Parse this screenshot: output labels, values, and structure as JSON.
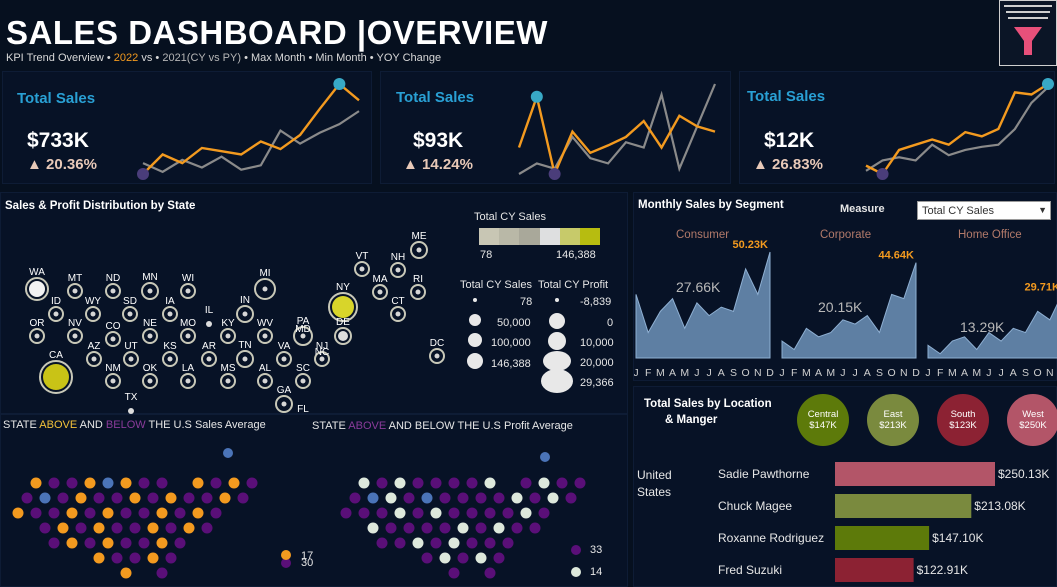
{
  "header": {
    "title": "SALES DASHBOARD |OVERVIEW",
    "subtitle_prefix": "KPI Trend Overview •",
    "subtitle_cy": "2022",
    "subtitle_vs": "vs •",
    "subtitle_py": "2021(CY vs PY)",
    "subtitle_max": "• Max Month",
    "subtitle_min": "• Min Month",
    "subtitle_yoy": "• YOY Change"
  },
  "colors": {
    "cy": "#f39a1f",
    "py": "#8a8a8a",
    "max_min": "#38a9c6",
    "min_dot": "#4a3d7a",
    "kpi_label": "#29a0d4",
    "above": "#f39a1f",
    "below": "#5a0f78",
    "area": "#5e7fa3"
  },
  "kpis": [
    {
      "label": "Total Sales",
      "value": "$733K",
      "change": "20.36%",
      "cy": [
        12,
        30,
        22,
        36,
        33,
        30,
        42,
        35,
        48,
        72,
        95,
        80
      ],
      "py": [
        22,
        14,
        25,
        18,
        28,
        16,
        20,
        52,
        40,
        50,
        58,
        70
      ]
    },
    {
      "label": "Total Sales",
      "value": "$93K",
      "change": "14.24%",
      "cy": [
        40,
        88,
        15,
        55,
        35,
        42,
        50,
        65,
        40,
        70,
        60,
        55
      ],
      "py": [
        15,
        25,
        20,
        50,
        30,
        25,
        45,
        40,
        90,
        20,
        60,
        100
      ]
    },
    {
      "label": "Total Sales",
      "value": "$12K",
      "change": "26.83%",
      "cy": [
        20,
        12,
        35,
        40,
        45,
        40,
        52,
        48,
        55,
        90,
        88,
        98
      ],
      "py": [
        15,
        25,
        28,
        25,
        40,
        30,
        35,
        38,
        40,
        55,
        80,
        95
      ]
    }
  ],
  "state_map": {
    "title": "Sales & Profit Distribution by State",
    "legend_title": "Total CY Sales",
    "legend_min": "78",
    "legend_max": "146,388",
    "size_legend_sales_title": "Total CY Sales",
    "size_legend_profit_title": "Total CY Profit",
    "size_legend_sales": [
      "78",
      "50,000",
      "100,000",
      "146,388"
    ],
    "size_legend_profit": [
      "-8,839",
      "0",
      "10,000",
      "20,000",
      "29,366"
    ],
    "states": [
      "WA",
      "MT",
      "ND",
      "MN",
      "WI",
      "MI",
      "VT",
      "NH",
      "ME",
      "ID",
      "WY",
      "SD",
      "IA",
      "IL",
      "IN",
      "NY",
      "MA",
      "RI",
      "OR",
      "NV",
      "CO",
      "NE",
      "MO",
      "KY",
      "WV",
      "PA",
      "CT",
      "CA",
      "AZ",
      "UT",
      "KS",
      "AR",
      "TN",
      "VA",
      "MD",
      "DE",
      "NJ",
      "DC",
      "NM",
      "OK",
      "LA",
      "MS",
      "AL",
      "SC",
      "NC",
      "TX",
      "GA",
      "FL"
    ]
  },
  "avg_maps": {
    "sales_title_a": "STATE ",
    "sales_title_above": "ABOVE",
    "sales_title_b": " AND ",
    "sales_title_below": "BELOW",
    "sales_title_c": " THE U.S Sales Average",
    "profit_title_a": "STATE ",
    "profit_title_above": "ABOVE",
    "profit_title_b": " AND BELOW THE U.S Profit Average",
    "sales_count_below": "30",
    "sales_count_above": "17",
    "profit_count_below": "33",
    "profit_count_above": "14"
  },
  "segments": {
    "title": "Monthly Sales by Segment",
    "measure_label": "Measure",
    "measure_selected": "Total CY Sales",
    "months": "JFMAMJJASOND",
    "items": [
      {
        "name": "Consumer",
        "peak": "50.23K",
        "avg": "27.66K",
        "values": [
          30,
          12,
          22,
          28,
          14,
          26,
          20,
          24,
          22,
          42,
          30,
          50
        ]
      },
      {
        "name": "Corporate",
        "peak": "44.64K",
        "avg": "20.15K",
        "values": [
          8,
          4,
          14,
          10,
          12,
          18,
          16,
          20,
          12,
          30,
          28,
          45
        ]
      },
      {
        "name": "Home Office",
        "peak": "29.71K",
        "avg": "13.29K",
        "values": [
          6,
          2,
          8,
          10,
          4,
          12,
          8,
          14,
          12,
          22,
          18,
          30
        ]
      }
    ]
  },
  "location": {
    "title_line1": "Total Sales by Location",
    "title_line2": "& Manger",
    "regions": [
      {
        "name": "Central",
        "value": "$147K",
        "color": "#5d7a0a"
      },
      {
        "name": "East",
        "value": "$213K",
        "color": "#7a8a3e"
      },
      {
        "name": "South",
        "value": "$123K",
        "color": "#8c2233"
      },
      {
        "name": "West",
        "value": "$250K",
        "color": "#b35568"
      }
    ],
    "country": "United States",
    "managers": [
      {
        "name": "Sadie Pawthorne",
        "value": 250.13,
        "label": "$250.13K",
        "color": "#b35568"
      },
      {
        "name": "Chuck Magee",
        "value": 213.08,
        "label": "$213.08K",
        "color": "#7a8a3e"
      },
      {
        "name": "Roxanne Rodriguez",
        "value": 147.1,
        "label": "$147.10K",
        "color": "#5d7a0a"
      },
      {
        "name": "Fred Suzuki",
        "value": 122.91,
        "label": "$122.91K",
        "color": "#8c2233"
      }
    ]
  }
}
